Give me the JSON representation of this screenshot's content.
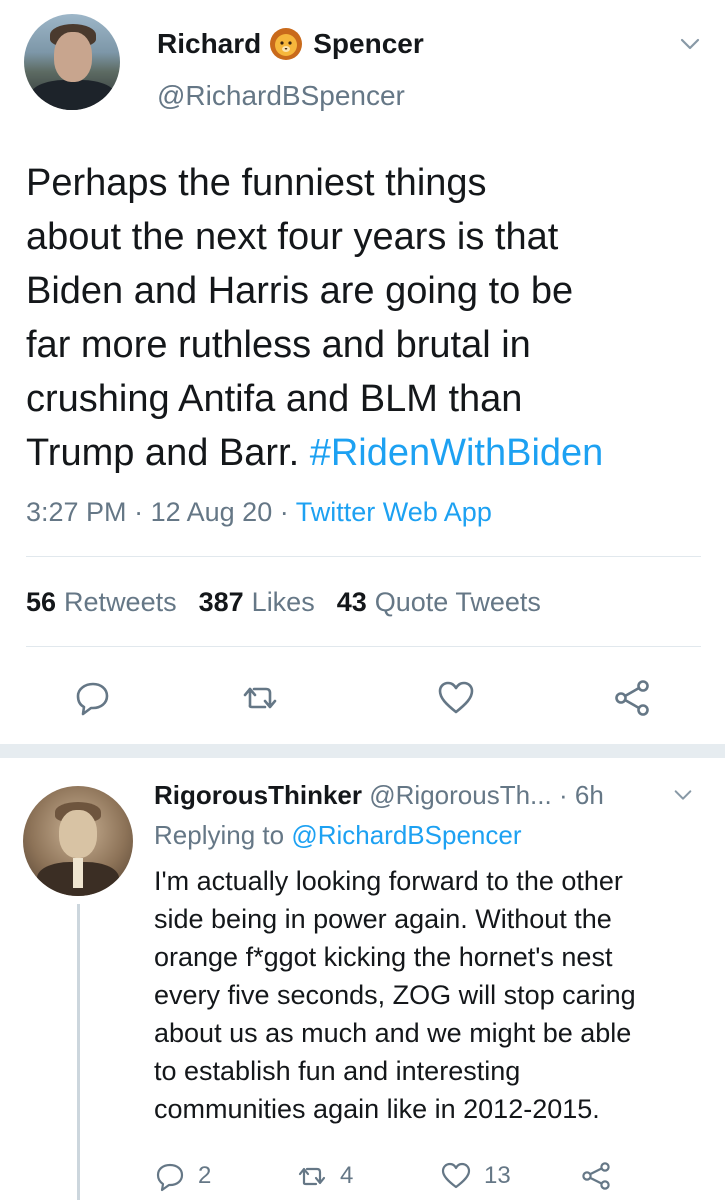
{
  "main_tweet": {
    "display_name_first": "Richard",
    "display_name_last": "Spencer",
    "name_emoji": "lion-face",
    "handle": "@RichardBSpencer",
    "text": "Perhaps the funniest things\nabout the next four years is that\nBiden and Harris are going to be\nfar more ruthless and brutal in\ncrushing Antifa and BLM than\nTrump and Barr. ",
    "hashtag": "#RidenWithBiden",
    "time": "3:27 PM",
    "date": "12 Aug 20",
    "separator": "·",
    "source": "Twitter Web App",
    "retweets_count": "56",
    "retweets_label": "Retweets",
    "likes_count": "387",
    "likes_label": "Likes",
    "quotes_count": "43",
    "quotes_label": "Quote Tweets"
  },
  "reply_tweet": {
    "display_name": "RigorousThinker",
    "handle": "@RigorousTh...",
    "separator": "·",
    "age": "6h",
    "replying_prefix": "Replying to",
    "replying_handle": "@RichardBSpencer",
    "text": "I'm actually looking forward to the other\nside being in power again. Without the\norange f*ggot kicking the hornet's nest\nevery five seconds, ZOG will stop caring\nabout us as much and we might be able\nto establish fun and interesting\ncommunities again like in 2012-2015.",
    "reply_count": "2",
    "retweet_count": "4",
    "like_count": "13"
  },
  "colors": {
    "link_blue": "#1da1f2",
    "text_primary": "#14171a",
    "text_secondary": "#657786",
    "divider": "#e1e8ed"
  },
  "icons": [
    "lion-face-icon",
    "chevron-down-icon",
    "reply-icon",
    "retweet-icon",
    "like-icon",
    "share-icon"
  ]
}
